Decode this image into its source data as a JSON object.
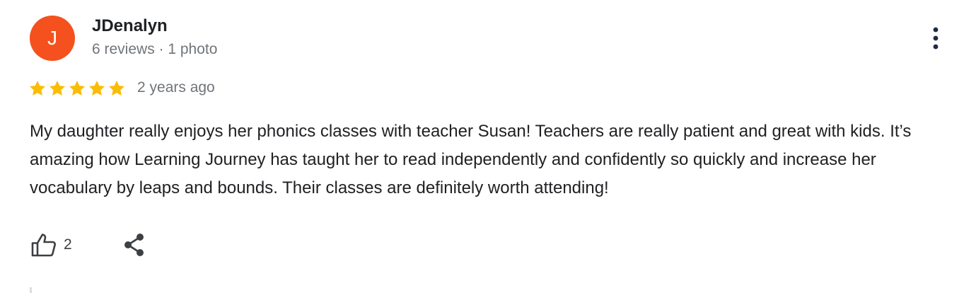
{
  "review": {
    "author": {
      "initial": "J",
      "name": "JDenalyn",
      "meta": "6 reviews · 1 photo",
      "avatar_color": "#f4511e"
    },
    "rating": 5,
    "rating_max": 5,
    "star_color": "#fbbc04",
    "date": "2 years ago",
    "text": "My daughter really enjoys her phonics classes with teacher Susan! Teachers are really patient and great with kids. It’s amazing how Learning Journey has taught her to read independently and confidently so quickly and increase her vocabulary by leaps and bounds. Their classes are definitely worth attending!",
    "actions": {
      "like_icon": "thumbs-up-icon",
      "like_count": "2",
      "share_icon": "share-icon",
      "more_icon": "more-vert-icon"
    }
  }
}
